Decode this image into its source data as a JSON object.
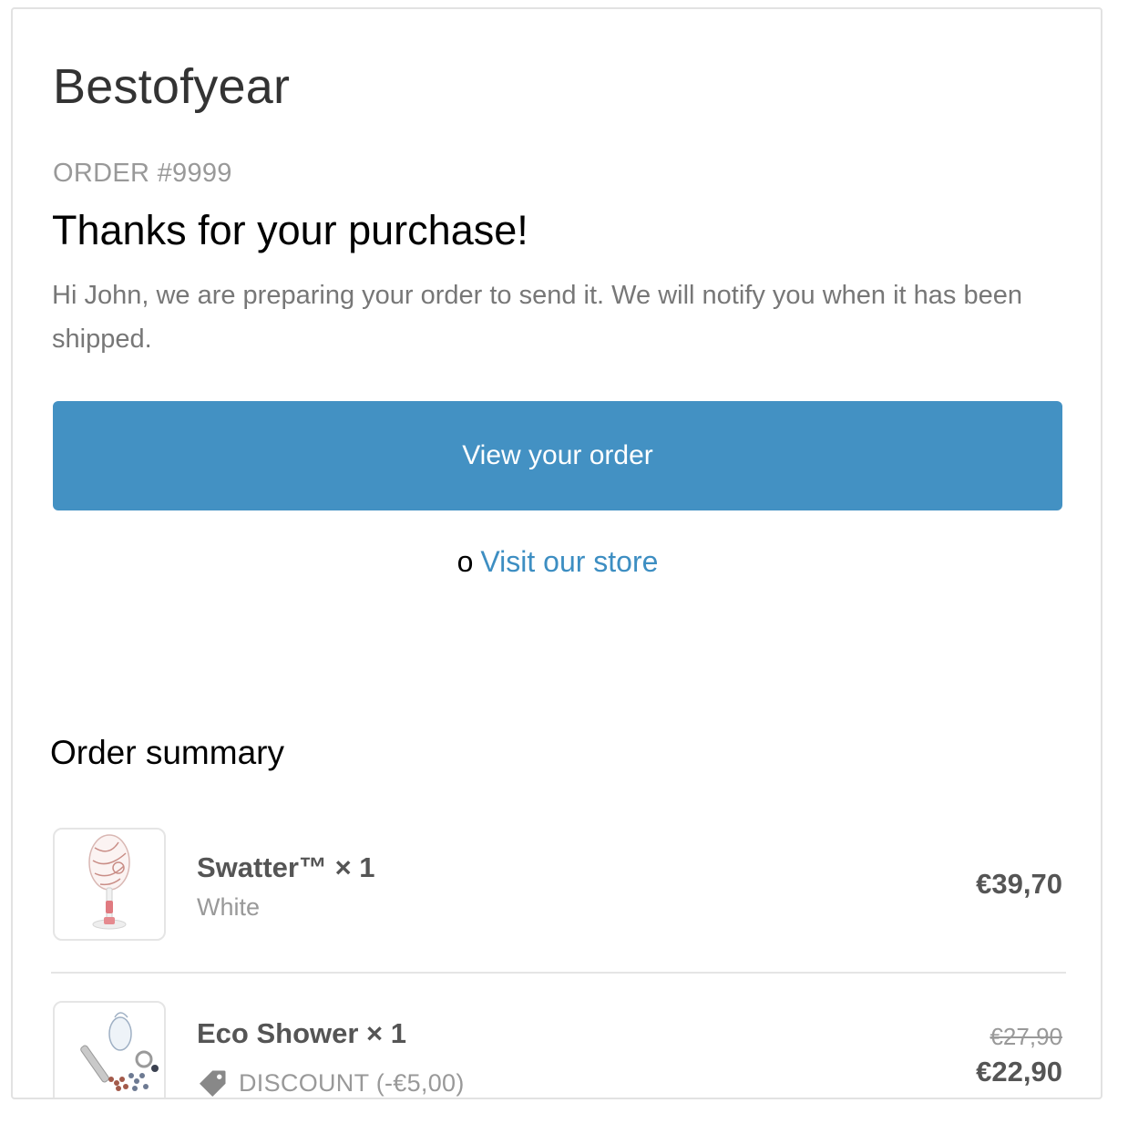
{
  "header": {
    "shop_name": "Bestofyear"
  },
  "order": {
    "number_label": "ORDER #9999",
    "heading": "Thanks for your purchase!",
    "message": "Hi John, we are preparing your order to send it. We will notify you when it has been shipped.",
    "view_button_label": "View your order",
    "or_text": "o",
    "store_link_label": "Visit our store"
  },
  "summary": {
    "heading": "Order summary",
    "items": [
      {
        "title": "Swatter™ × 1",
        "variant": "White",
        "price": "€39,70",
        "thumbnail_icon": "electric-swatter-image"
      },
      {
        "title": "Eco Shower × 1",
        "discount_label": "DISCOUNT (-€5,00)",
        "original_price": "€27,90",
        "final_price": "€22,90",
        "thumbnail_icon": "shower-head-kit-image",
        "discount_icon": "tag-icon"
      }
    ]
  },
  "colors": {
    "button_bg": "#4391c3",
    "link": "#3d8ec2",
    "muted_text": "#999999",
    "body_text": "#777777",
    "item_text": "#555555"
  }
}
